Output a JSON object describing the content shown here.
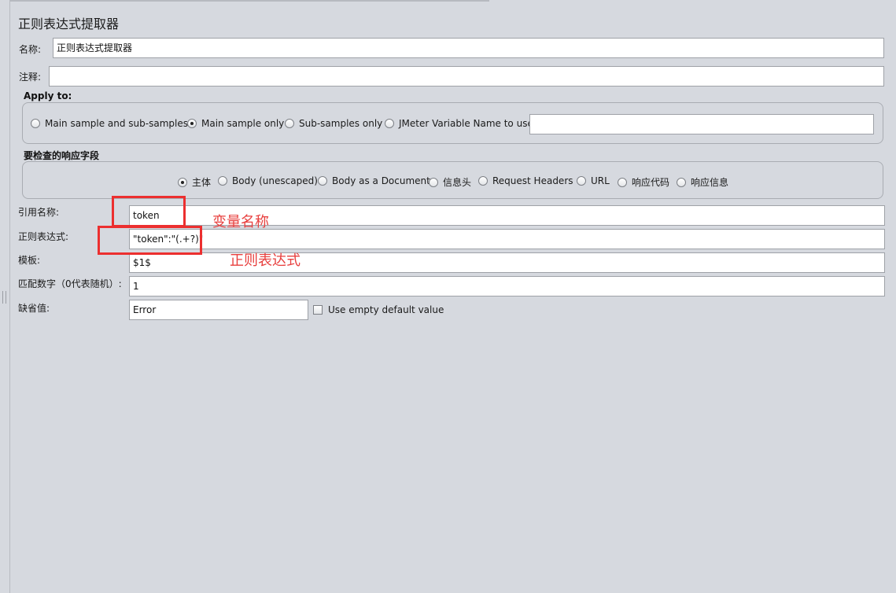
{
  "panel": {
    "title": "正则表达式提取器"
  },
  "name_row": {
    "label": "名称:",
    "value": "正则表达式提取器"
  },
  "comment_row": {
    "label": "注释:",
    "value": ""
  },
  "apply_to": {
    "title": "Apply to:",
    "options": [
      "Main sample and sub-samples",
      "Main sample only",
      "Sub-samples only",
      "JMeter Variable Name to use"
    ],
    "selected": "Main sample only",
    "variable_value": ""
  },
  "response_field": {
    "title": "要检查的响应字段",
    "options": [
      "主体",
      "Body (unescaped)",
      "Body as a Document",
      "信息头",
      "Request Headers",
      "URL",
      "响应代码",
      "响应信息"
    ],
    "selected": "主体"
  },
  "form": {
    "ref_name": {
      "label": "引用名称:",
      "value": "token"
    },
    "regex": {
      "label": "正则表达式:",
      "value": "\"token\":\"(.+?)\""
    },
    "template": {
      "label": "模板:",
      "value": "$1$"
    },
    "match_no": {
      "label": "匹配数字（0代表随机）:",
      "value": "1"
    },
    "default_value": {
      "label": "缺省值:",
      "value": "Error"
    },
    "use_empty_default": {
      "label": "Use empty default value",
      "checked": false
    }
  },
  "annotations": {
    "variable_name": "变量名称",
    "regex": "正则表达式",
    "color": "#e8403f"
  }
}
